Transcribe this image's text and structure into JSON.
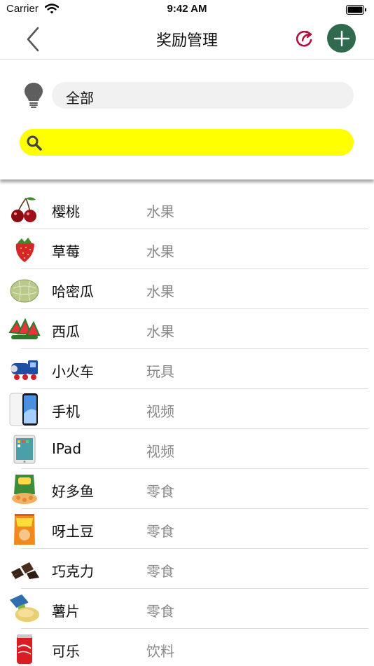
{
  "status_bar": {
    "carrier": "Carrier",
    "time": "9:42 AM"
  },
  "nav": {
    "title": "奖励管理",
    "back_icon": "chevron-left-icon",
    "share_icon": "share-arrow-icon",
    "add_icon": "plus-icon"
  },
  "filter": {
    "category": "全部",
    "search_value": "",
    "search_color": "#ffff00"
  },
  "colors": {
    "accent_green": "#2f6a4f",
    "share_red": "#b0103a"
  },
  "rewards": [
    {
      "name": "樱桃",
      "category": "水果",
      "icon": "cherry-icon"
    },
    {
      "name": "草莓",
      "category": "水果",
      "icon": "strawberry-icon"
    },
    {
      "name": "哈密瓜",
      "category": "水果",
      "icon": "melon-icon"
    },
    {
      "name": "西瓜",
      "category": "水果",
      "icon": "watermelon-icon"
    },
    {
      "name": "小火车",
      "category": "玩具",
      "icon": "toy-train-icon"
    },
    {
      "name": "手机",
      "category": "视频",
      "icon": "phone-icon"
    },
    {
      "name": "IPad",
      "category": "视频",
      "icon": "tablet-icon"
    },
    {
      "name": "好多鱼",
      "category": "零食",
      "icon": "snack-bag-icon"
    },
    {
      "name": "呀土豆",
      "category": "零食",
      "icon": "chips-bag-icon"
    },
    {
      "name": "巧克力",
      "category": "零食",
      "icon": "chocolate-icon"
    },
    {
      "name": "薯片",
      "category": "零食",
      "icon": "potato-chips-icon"
    },
    {
      "name": "可乐",
      "category": "饮料",
      "icon": "cola-can-icon"
    }
  ]
}
